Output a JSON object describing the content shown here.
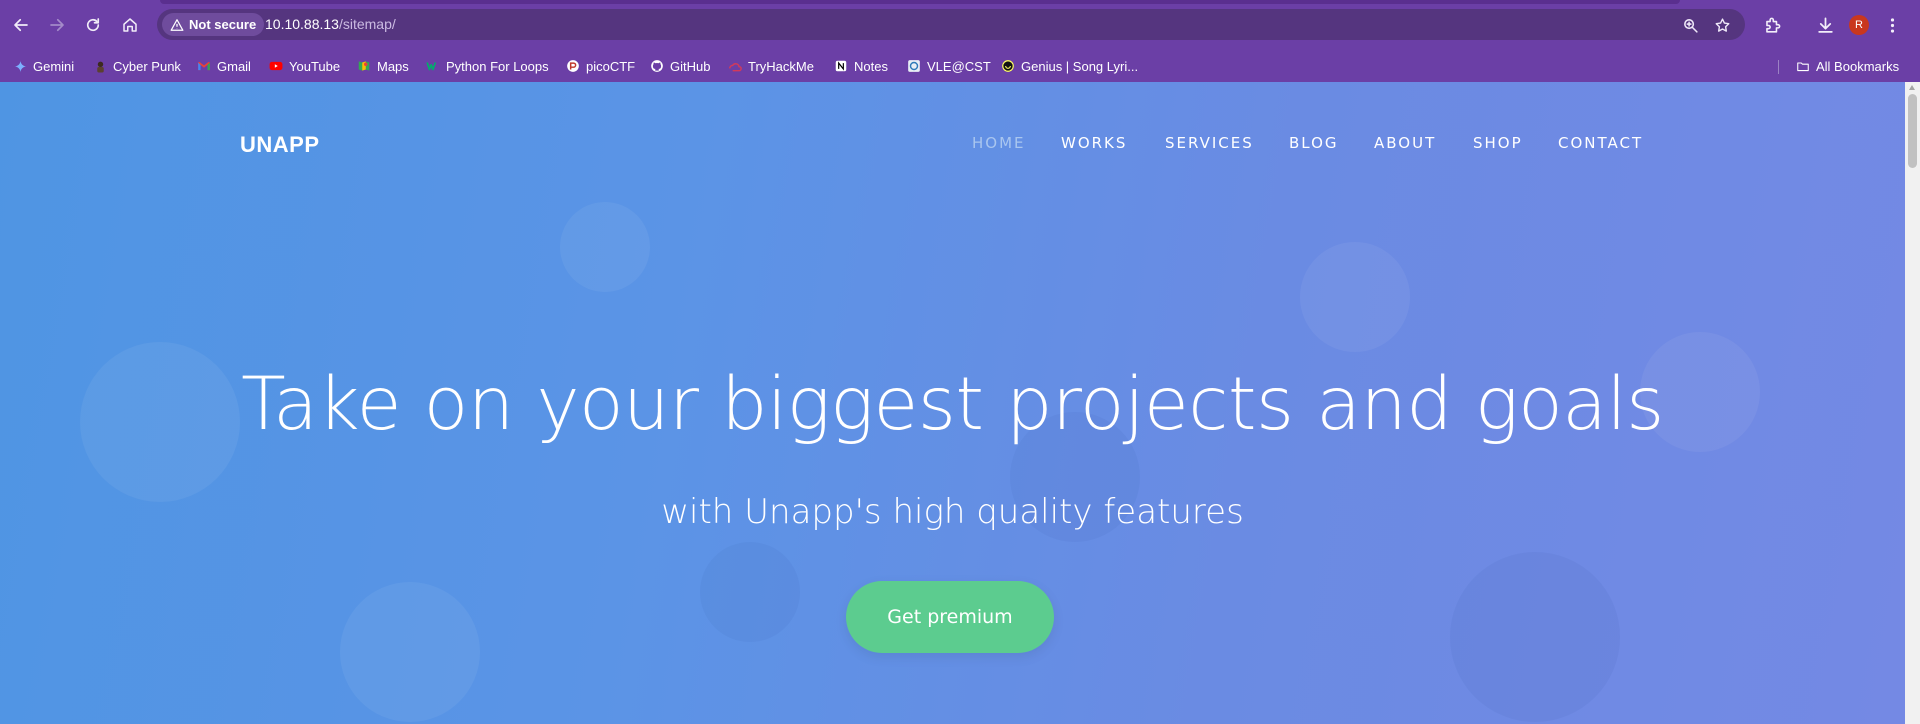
{
  "browser": {
    "security_label": "Not secure",
    "url_host": "10.10.88.13",
    "url_path": "/sitemap/",
    "profile_initial": "R",
    "bookmarks": [
      {
        "label": "Gemini",
        "icon": "gemini-icon"
      },
      {
        "label": "Cyber Punk",
        "icon": "cyberpunk-icon"
      },
      {
        "label": "Gmail",
        "icon": "gmail-icon"
      },
      {
        "label": "YouTube",
        "icon": "youtube-icon"
      },
      {
        "label": "Maps",
        "icon": "maps-icon"
      },
      {
        "label": "Python For Loops",
        "icon": "w3schools-icon"
      },
      {
        "label": "picoCTF",
        "icon": "picoctf-icon"
      },
      {
        "label": "GitHub",
        "icon": "github-icon"
      },
      {
        "label": "TryHackMe",
        "icon": "tryhackme-icon"
      },
      {
        "label": "Notes",
        "icon": "notion-icon"
      },
      {
        "label": "VLE@CST",
        "icon": "vle-icon"
      },
      {
        "label": "Genius | Song Lyri...",
        "icon": "genius-icon"
      }
    ],
    "all_bookmarks_label": "All Bookmarks"
  },
  "site": {
    "brand": "UNAPP",
    "nav": [
      "HOME",
      "WORKS",
      "SERVICES",
      "BLOG",
      "ABOUT",
      "SHOP",
      "CONTACT"
    ],
    "active_nav": "HOME",
    "hero_title": "Take on your biggest projects and goals",
    "hero_subtitle": "with Unapp's high quality features",
    "cta_label": "Get premium"
  },
  "colors": {
    "chrome": "#6b3fa6",
    "omnibox": "#55357f",
    "hero_gradient_start": "#4f95e3",
    "hero_gradient_end": "#7489e4",
    "cta": "#5ccc8f",
    "nav_active": "#a9c6ef"
  }
}
